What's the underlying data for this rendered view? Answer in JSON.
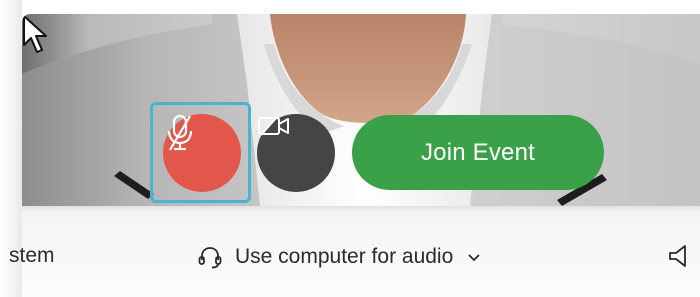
{
  "preview": {
    "mute_button": {
      "icon": "microphone-muted-icon",
      "state": "muted",
      "color": "#e3564c"
    },
    "video_button": {
      "icon": "video-off-icon",
      "state": "off",
      "color": "#454545"
    },
    "join_button": {
      "label": "Join Event",
      "color": "#3aa148"
    },
    "focus_ring_color": "#49b4cd"
  },
  "audio_bar": {
    "left_label": "stem",
    "audio_option": {
      "icon": "headset-icon",
      "label": "Use computer for audio",
      "dropdown_icon": "chevron-down-icon"
    },
    "speaker_icon": "speaker-icon"
  }
}
